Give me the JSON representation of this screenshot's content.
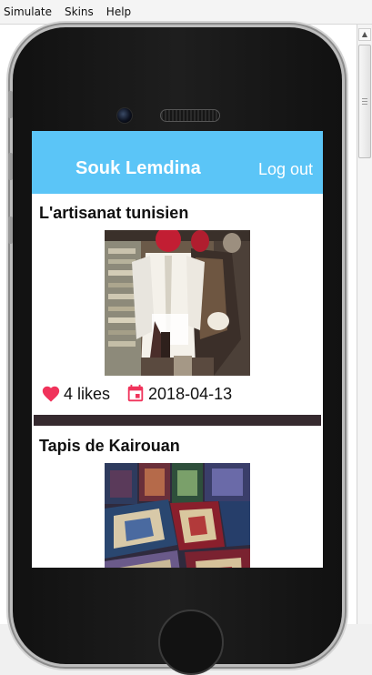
{
  "menubar": {
    "items": [
      "Simulate",
      "Skins",
      "Help"
    ]
  },
  "app": {
    "title": "Souk Lemdina",
    "logout_label": "Log out",
    "accent_color": "#5bc5f7"
  },
  "posts": [
    {
      "title": "L'artisanat tunisien",
      "image": "traditional-garments-photo",
      "likes_label": "4 likes",
      "date": "2018-04-13",
      "like_icon": "heart-icon",
      "date_icon": "calendar-icon"
    },
    {
      "title": "Tapis de Kairouan",
      "image": "kairouan-carpets-photo"
    }
  ]
}
